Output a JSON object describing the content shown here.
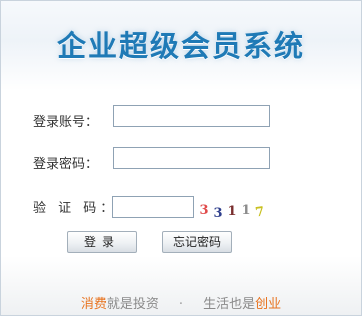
{
  "title": "企业超级会员系统",
  "form": {
    "account_label": "登录账号：",
    "account_value": "",
    "password_label": "登录密码：",
    "password_value": "",
    "captcha_label": "验 证 码：",
    "captcha_value": "",
    "captcha_chars": [
      {
        "char": "3",
        "color": "#e04a4a"
      },
      {
        "char": "3",
        "color": "#2e3e8c"
      },
      {
        "char": "1",
        "color": "#7a2f2f"
      },
      {
        "char": "1",
        "color": "#8c8c8c"
      },
      {
        "char": "7",
        "color": "#c8c020"
      }
    ]
  },
  "buttons": {
    "login": "登录",
    "forgot_password": "忘记密码"
  },
  "footer": {
    "left_accent": "消费",
    "left_rest": "就是投资",
    "separator": "·",
    "right_rest": "生活也是",
    "right_accent": "创业"
  }
}
